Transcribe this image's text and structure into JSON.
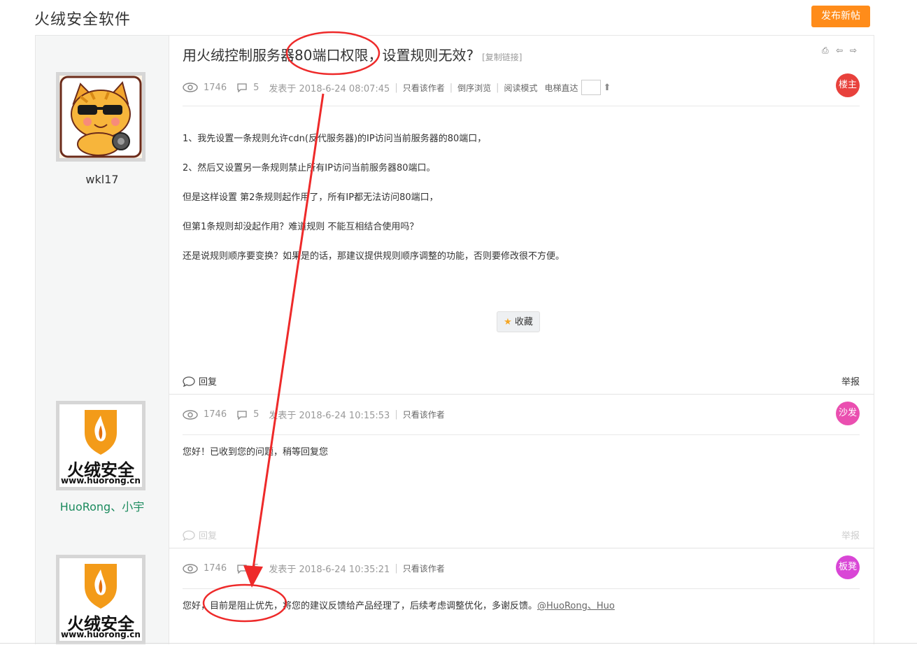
{
  "site": {
    "title": "火绒安全软件",
    "new_post_label": "发布新帖"
  },
  "thread": {
    "title": "用火绒控制服务器80端口权限，设置规则无效?",
    "copy_link": "[复制链接]",
    "views": "1746",
    "replies": "5",
    "links": {
      "only_author": "只看该作者",
      "reverse": "倒序浏览",
      "read_mode": "阅读模式",
      "elevator": "电梯直达"
    },
    "favorite_label": "收藏",
    "reply_label": "回复",
    "report_label": "举报"
  },
  "posts": [
    {
      "author": "wkl17",
      "posted": "发表于 2018-6-24 08:07:45",
      "floor": "楼主",
      "floor_color": "#e8413c",
      "lines": [
        "1、我先设置一条规则允许cdn(反代服务器)的IP访问当前服务器的80端口，",
        "2、然后又设置另一条规则禁止所有IP访问当前服务器80端口。",
        "但是这样设置 第2条规则起作用了，所有IP都无法访问80端口，",
        "但第1条规则却没起作用？难道规则 不能互相结合使用吗？",
        "还是说规则顺序要变换？如果是的话，那建议提供规则顺序调整的功能，否则要修改很不方便。"
      ]
    },
    {
      "author": "HuoRong、小宇",
      "posted": "发表于 2018-6-24 10:15:53",
      "floor": "沙发",
      "floor_color": "#ea4fb0",
      "lines": [
        "您好！已收到您的问题，稍等回复您"
      ]
    },
    {
      "author": "",
      "posted": "发表于 2018-6-24 10:35:21",
      "floor": "板凳",
      "floor_color": "#d946d6",
      "lines": [
        "您好，目前是阻止优先，将您的建议反馈给产品经理了，后续考虑调整优化，多谢反馈。"
      ],
      "mention": "@HuoRong、Huo"
    }
  ],
  "logo": {
    "name": "火绒安全",
    "url": "www.huorong.cn"
  },
  "colors": {
    "accent": "#ff8c1a",
    "annotation": "#ee2a2a"
  }
}
